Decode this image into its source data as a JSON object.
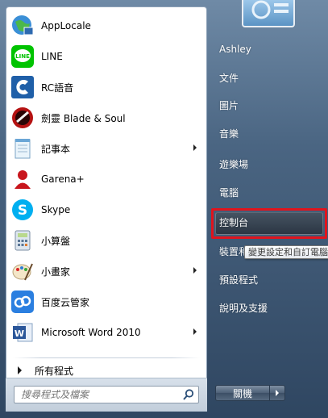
{
  "programs": [
    {
      "label": "AppLocale",
      "icon": "applocale-icon",
      "submenu": false
    },
    {
      "label": "LINE",
      "icon": "line-icon",
      "submenu": false
    },
    {
      "label": "RC語音",
      "icon": "rc-voice-icon",
      "submenu": false
    },
    {
      "label": "劍靈 Blade & Soul",
      "icon": "blade-and-soul-icon",
      "submenu": false
    },
    {
      "label": "記事本",
      "icon": "notepad-icon",
      "submenu": true
    },
    {
      "label": "Garena+",
      "icon": "garena-icon",
      "submenu": false
    },
    {
      "label": "Skype",
      "icon": "skype-icon",
      "submenu": false
    },
    {
      "label": "小算盤",
      "icon": "calculator-icon",
      "submenu": false
    },
    {
      "label": "小畫家",
      "icon": "paint-icon",
      "submenu": true
    },
    {
      "label": "百度云管家",
      "icon": "baidu-cloud-icon",
      "submenu": false
    },
    {
      "label": "Microsoft Word 2010",
      "icon": "word-icon",
      "submenu": true
    }
  ],
  "all_programs": "所有程式",
  "search": {
    "placeholder": "搜尋程式及檔案"
  },
  "right_links": {
    "user": "Ashley",
    "documents": "文件",
    "pictures": "圖片",
    "music": "音樂",
    "games": "遊樂場",
    "computer": "電腦",
    "control_panel": "控制台",
    "devices": "裝置和",
    "default_programs": "預設程式",
    "help": "說明及支援"
  },
  "tooltip": "變更設定和自訂電腦",
  "shutdown": {
    "label": "關機"
  },
  "colors": {
    "highlight_border": "#e0141d",
    "line_green": "#00c300",
    "skype_blue": "#00aff0"
  }
}
